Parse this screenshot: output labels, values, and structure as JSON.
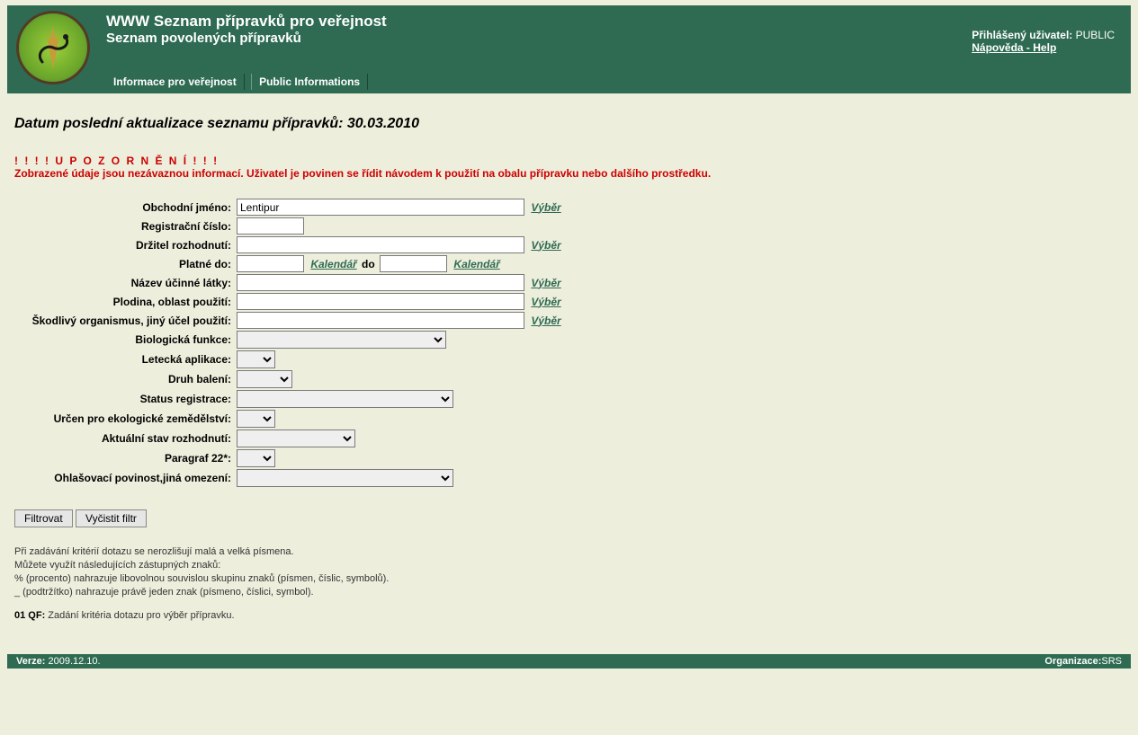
{
  "header": {
    "title": "WWW Seznam přípravků pro veřejnost",
    "subtitle": "Seznam povolených přípravků",
    "logged_in_label": "Přihlášený uživatel:",
    "logged_in_user": "PUBLIC",
    "help_link": "Nápověda - Help"
  },
  "nav": {
    "item1": "Informace pro veřejnost",
    "item2": "Public Informations"
  },
  "update_line": "Datum poslední aktualizace seznamu přípravků: 30.03.2010",
  "warning": {
    "title": "! ! ! ! U P O Z O R N Ě N Í ! ! !",
    "text": "Zobrazené údaje jsou nezávaznou informací. Uživatel je povinen se řídit návodem k použití na obalu přípravku nebo dalšího prostředku."
  },
  "form": {
    "labels": {
      "obchodni_jmeno": "Obchodní jméno:",
      "registracni_cislo": "Registrační číslo:",
      "drzitel": "Držitel rozhodnutí:",
      "platne_do": "Platné do:",
      "do": "do",
      "nazev_latky": "Název účinné látky:",
      "plodina": "Plodina, oblast použití:",
      "skodlivy": "Škodlivý organismus, jiný účel použití:",
      "bio_funkce": "Biologická funkce:",
      "letecka": "Letecká aplikace:",
      "balen": "Druh balení:",
      "status": "Status registrace:",
      "eko": "Určen pro ekologické zemědělství:",
      "stav": "Aktuální stav rozhodnutí:",
      "paragraf": "Paragraf 22*:",
      "ohlasovaci": "Ohlašovací povinost,jiná omezení:"
    },
    "values": {
      "obchodni_jmeno": "Lentipur",
      "registracni_cislo": "",
      "drzitel": "",
      "platne_do_from": "",
      "platne_do_to": "",
      "nazev_latky": "",
      "plodina": "",
      "skodlivy": ""
    },
    "links": {
      "vyber": "Výběr",
      "kalendar": "Kalendář"
    }
  },
  "buttons": {
    "filter": "Filtrovat",
    "clear": "Vyčistit filtr"
  },
  "help": {
    "l1": "Při zadávání kritérií dotazu se nerozlišují malá a velká písmena.",
    "l2": "Můžete využít následujících zástupných znaků:",
    "l3": "% (procento) nahrazuje libovolnou souvislou skupinu znaků (písmen, číslic, symbolů).",
    "l4": "_ (podtržítko) nahrazuje právě jeden znak (písmeno, číslici, symbol).",
    "qf_label": "01 QF:",
    "qf_text": " Zadání kritéria dotazu pro výběr přípravku."
  },
  "footer": {
    "verze_label": "Verze: ",
    "verze_value": "2009.12.10.",
    "org_label": "Organizace:",
    "org_value": "SRS"
  }
}
